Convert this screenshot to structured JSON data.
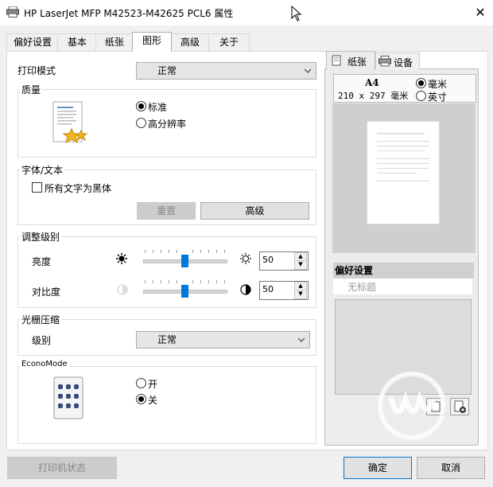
{
  "window": {
    "title": "HP LaserJet MFP M42523-M42625 PCL6 属性",
    "close_glyph": "✕"
  },
  "tabs": [
    {
      "label": "偏好设置",
      "active": false
    },
    {
      "label": "基本",
      "active": false
    },
    {
      "label": "纸张",
      "active": false
    },
    {
      "label": "图形",
      "active": true
    },
    {
      "label": "高级",
      "active": false
    },
    {
      "label": "关于",
      "active": false
    }
  ],
  "print_mode": {
    "label": "打印模式",
    "value": "正常"
  },
  "quality": {
    "group_label": "质量",
    "options": [
      {
        "label": "标准",
        "selected": true
      },
      {
        "label": "高分辨率",
        "selected": false
      }
    ]
  },
  "font_text": {
    "group_label": "字体/文本",
    "checkbox_label": "所有文字为黑体",
    "checked": false,
    "reset_label": "重置",
    "advanced_label": "高级"
  },
  "adjust": {
    "group_label": "调整级别",
    "brightness": {
      "label": "亮度",
      "value": "50",
      "slider_level": 0.5
    },
    "contrast": {
      "label": "对比度",
      "value": "50",
      "slider_level": 0.5
    }
  },
  "raster": {
    "group_label": "光栅压缩",
    "level_label": "级别",
    "level_value": "正常"
  },
  "econo": {
    "group_label": "EconoMode",
    "options": [
      {
        "label": "开",
        "selected": false
      },
      {
        "label": "关",
        "selected": true
      }
    ]
  },
  "right_panel": {
    "tabs": [
      {
        "label": "纸张",
        "active": true
      },
      {
        "label": "设备",
        "active": false
      }
    ],
    "paper_name": "A4",
    "paper_size": "210 x 297 毫米",
    "units": [
      {
        "label": "毫米",
        "selected": true
      },
      {
        "label": "英寸",
        "selected": false
      }
    ],
    "preferences_label": "偏好设置",
    "preferences_item": "无标题"
  },
  "footer": {
    "printer_status_label": "打印机状态",
    "ok_label": "确定",
    "cancel_label": "取消"
  },
  "icons": [
    "printer-icon",
    "close-icon",
    "cursor-icon",
    "quality-document-icon",
    "brightness-low-icon",
    "brightness-high-icon",
    "contrast-low-icon",
    "contrast-high-icon",
    "econo-toner-icon",
    "paper-icon",
    "printer-device-icon",
    "save-icon",
    "add-icon",
    "watermark-logo-icon"
  ],
  "colors": {
    "accent": "#0078d7",
    "panel_bg": "#ececec"
  }
}
